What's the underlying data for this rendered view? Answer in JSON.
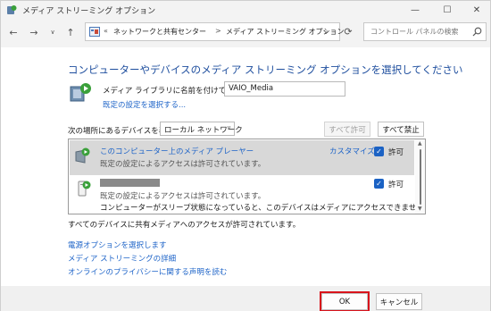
{
  "window": {
    "title": "メディア ストリーミング オプション",
    "min_glyph": "—",
    "max_glyph": "☐",
    "close_glyph": "✕"
  },
  "nav": {
    "back": "←",
    "forward": "→",
    "recent": "∨",
    "up": "↑"
  },
  "address": {
    "overflow": "«",
    "crumbs": [
      "ネットワークと共有センター",
      "メディア ストリーミング オプション"
    ],
    "separator": ">",
    "dropdown": "∨",
    "refresh": "⟳"
  },
  "search": {
    "placeholder": "コントロール パネルの検索"
  },
  "main": {
    "heading": "コンピューターやデバイスのメディア ストリーミング オプションを選択してください",
    "library_label": "メディア ライブラリに名前を付けてください:",
    "library_name": "VAIO_Media",
    "defaults_link": "既定の設定を選択する...",
    "show_label": "次の場所にあるデバイスを表示:",
    "show_value": "ローカル ネットワーク",
    "allow_all": "すべて許可",
    "block_all": "すべて禁止"
  },
  "devices": [
    {
      "name": "このコンピューター上のメディア プレーヤー",
      "desc": "既定の設定によるアクセスは許可されています。",
      "customize": "カスタマイズ...",
      "allowed_label": "許可",
      "checked": true,
      "selected": true
    },
    {
      "name": "",
      "desc": "既定の設定によるアクセスは許可されています。",
      "note": "コンピューターがスリープ状態になっていると、このデバイスはメディアにアクセスできません。",
      "allowed_label": "許可",
      "checked": true,
      "selected": false
    }
  ],
  "status": "すべてのデバイスに共有メディアへのアクセスが許可されています。",
  "links": {
    "power": "電源オプションを選択します",
    "more": "メディア ストリーミングの詳細",
    "privacy": "オンラインのプライバシーに関する声明を読む"
  },
  "footer": {
    "ok": "OK",
    "cancel": "キャンセル"
  },
  "colors": {
    "heading": "#1e4e9e",
    "link": "#1e64c8",
    "checkbox": "#1b62c4",
    "highlight": "#d8141c"
  }
}
